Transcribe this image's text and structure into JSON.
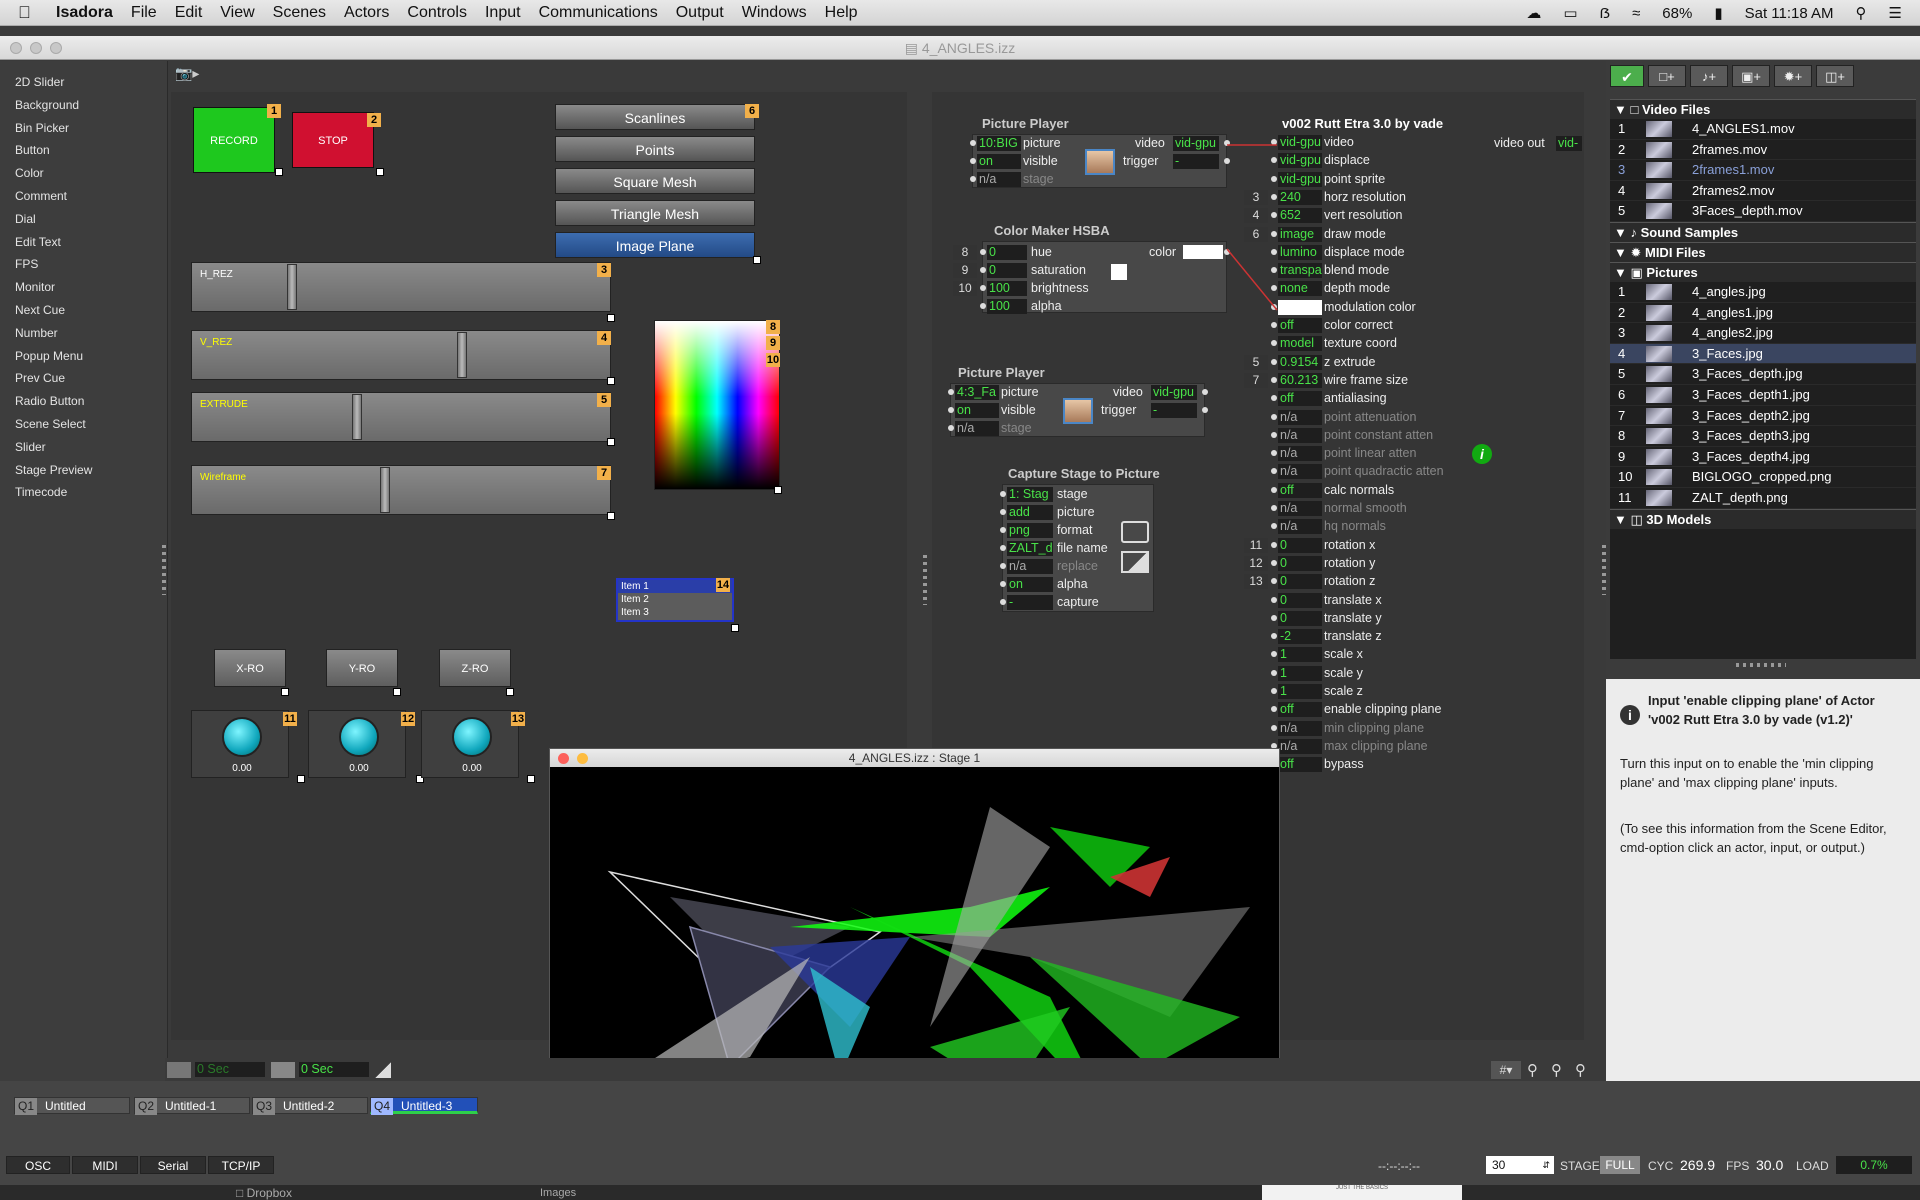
{
  "menubar": {
    "app": "Isadora",
    "items": [
      "File",
      "Edit",
      "View",
      "Scenes",
      "Actors",
      "Controls",
      "Input",
      "Communications",
      "Output",
      "Windows",
      "Help"
    ],
    "battery": "68%",
    "clock": "Sat 11:18 AM"
  },
  "window": {
    "title": "4_ANGLES.izz"
  },
  "toolbox": [
    "2D Slider",
    "Background",
    "Bin Picker",
    "Button",
    "Color",
    "Comment",
    "Dial",
    "Edit Text",
    "FPS",
    "Monitor",
    "Next Cue",
    "Number",
    "Popup Menu",
    "Prev Cue",
    "Radio Button",
    "Scene Select",
    "Slider",
    "Stage Preview",
    "Timecode"
  ],
  "control": {
    "record": "RECORD",
    "record_id": "1",
    "stop": "STOP",
    "stop_id": "2",
    "radio": [
      "Scanlines",
      "Points",
      "Square Mesh",
      "Triangle Mesh",
      "Image Plane"
    ],
    "radio_id": "6",
    "sliders": [
      {
        "label": "H_REZ",
        "id": "3",
        "value": 0.16
      },
      {
        "label": "V_REZ",
        "id": "4",
        "value": 0.52
      },
      {
        "label": "EXTRUDE",
        "id": "5",
        "value": 0.32
      },
      {
        "label": "Wireframe",
        "id": "7",
        "value": 0.38
      }
    ],
    "color_ids": [
      "8",
      "9",
      "10"
    ],
    "popup": [
      "Item 1",
      "Item 2",
      "Item 3"
    ],
    "popup_id": "14",
    "knobs": [
      {
        "label": "X-RO",
        "id": "11",
        "value": "0.00"
      },
      {
        "label": "Y-RO",
        "id": "12",
        "value": "0.00"
      },
      {
        "label": "Z-RO",
        "id": "13",
        "value": "0.00"
      }
    ]
  },
  "pp1": {
    "title": "Picture Player",
    "rows": [
      [
        "10:BIG",
        "picture"
      ],
      [
        "on",
        "visible"
      ],
      [
        "n/a",
        "stage"
      ]
    ],
    "out": [
      [
        "video",
        "vid-gpu"
      ],
      [
        "trigger",
        "-"
      ]
    ]
  },
  "cm": {
    "title": "Color Maker HSBA",
    "rows": [
      [
        "8",
        "0",
        "hue"
      ],
      [
        "9",
        "0",
        "saturation"
      ],
      [
        "10",
        "100",
        "brightness"
      ],
      [
        "",
        "100",
        "alpha"
      ]
    ],
    "out": "color"
  },
  "pp2": {
    "title": "Picture Player",
    "rows": [
      [
        "4:3_Fa",
        "picture"
      ],
      [
        "on",
        "visible"
      ],
      [
        "n/a",
        "stage"
      ]
    ],
    "out": [
      [
        "video",
        "vid-gpu"
      ],
      [
        "trigger",
        "-"
      ]
    ]
  },
  "cap": {
    "title": "Capture Stage to Picture",
    "rows": [
      [
        "1: Stag",
        "stage"
      ],
      [
        "add",
        "picture"
      ],
      [
        "png",
        "format"
      ],
      [
        "ZALT_d",
        "file name"
      ],
      [
        "n/a",
        "replace"
      ],
      [
        "on",
        "alpha"
      ],
      [
        "-",
        "capture"
      ]
    ]
  },
  "rutt": {
    "title": "v002 Rutt Etra 3.0 by vade",
    "out": "video out",
    "out_val": "vid-",
    "rows": [
      [
        "",
        "vid-gpu",
        "video",
        0
      ],
      [
        "",
        "vid-gpu",
        "displace",
        0
      ],
      [
        "",
        "vid-gpu",
        "point sprite",
        0
      ],
      [
        "3",
        "240",
        "horz resolution",
        0
      ],
      [
        "4",
        "652",
        "vert resolution",
        0
      ],
      [
        "6",
        "image",
        "draw mode",
        0
      ],
      [
        "",
        "lumino",
        "displace mode",
        0
      ],
      [
        "",
        "transpa",
        "blend mode",
        0
      ],
      [
        "",
        "none",
        "depth mode",
        0
      ],
      [
        "",
        "",
        "modulation color",
        0
      ],
      [
        "",
        "off",
        "color correct",
        0
      ],
      [
        "",
        "model",
        "texture coord",
        0
      ],
      [
        "5",
        "0.9154",
        "z extrude",
        0
      ],
      [
        "7",
        "60.213",
        "wire frame size",
        0
      ],
      [
        "",
        "off",
        "antialiasing",
        0
      ],
      [
        "",
        "n/a",
        "point attenuation",
        1
      ],
      [
        "",
        "n/a",
        "point constant atten",
        1
      ],
      [
        "",
        "n/a",
        "point linear atten",
        1
      ],
      [
        "",
        "n/a",
        "point quadractic atten",
        1
      ],
      [
        "",
        "off",
        "calc normals",
        0
      ],
      [
        "",
        "n/a",
        "normal smooth",
        1
      ],
      [
        "",
        "n/a",
        "hq normals",
        1
      ],
      [
        "11",
        "0",
        "rotation x",
        0
      ],
      [
        "12",
        "0",
        "rotation y",
        0
      ],
      [
        "13",
        "0",
        "rotation z",
        0
      ],
      [
        "",
        "0",
        "translate x",
        0
      ],
      [
        "",
        "0",
        "translate y",
        0
      ],
      [
        "",
        "-2",
        "translate z",
        0
      ],
      [
        "",
        "1",
        "scale x",
        0
      ],
      [
        "",
        "1",
        "scale y",
        0
      ],
      [
        "",
        "1",
        "scale z",
        0
      ],
      [
        "",
        "off",
        "enable clipping plane",
        0
      ],
      [
        "",
        "n/a",
        "min clipping plane",
        1
      ],
      [
        "",
        "n/a",
        "max clipping plane",
        1
      ],
      [
        "",
        "off",
        "bypass",
        0
      ]
    ]
  },
  "stage": {
    "title": "4_ANGLES.izz : Stage 1"
  },
  "media": {
    "video_head": "Video Files",
    "video": [
      [
        "1",
        "4_ANGLES1.mov"
      ],
      [
        "2",
        "2frames.mov"
      ],
      [
        "3",
        "2frames1.mov"
      ],
      [
        "4",
        "2frames2.mov"
      ],
      [
        "5",
        "3Faces_depth.mov"
      ]
    ],
    "sound_head": "Sound Samples",
    "midi_head": "MIDI Files",
    "pictures_head": "Pictures",
    "pictures": [
      [
        "1",
        "4_angles.jpg"
      ],
      [
        "2",
        "4_angles1.jpg"
      ],
      [
        "3",
        "4_angles2.jpg"
      ],
      [
        "4",
        "3_Faces.jpg"
      ],
      [
        "5",
        "3_Faces_depth.jpg"
      ],
      [
        "6",
        "3_Faces_depth1.jpg"
      ],
      [
        "7",
        "3_Faces_depth2.jpg"
      ],
      [
        "8",
        "3_Faces_depth3.jpg"
      ],
      [
        "9",
        "3_Faces_depth4.jpg"
      ],
      [
        "10",
        "BIGLOGO_cropped.png"
      ],
      [
        "11",
        "ZALT_depth.png"
      ]
    ],
    "models_head": "3D Models"
  },
  "info": {
    "title": "Input 'enable clipping plane' of Actor 'v002 Rutt Etra 3.0 by vade (v1.2)'",
    "body": "Turn this input on to enable the 'min clipping plane' and 'max clipping plane' inputs.",
    "hint": "(To see this information from the Scene Editor, cmd-option click an actor, input, or output.)"
  },
  "timebar": {
    "t1": "0 Sec",
    "t2": "0 Sec"
  },
  "scenes": [
    [
      "Q1",
      "Untitled"
    ],
    [
      "Q2",
      "Untitled-1"
    ],
    [
      "Q3",
      "Untitled-2"
    ],
    [
      "Q4",
      "Untitled-3"
    ]
  ],
  "bottom": {
    "buttons": [
      "OSC",
      "MIDI",
      "Serial",
      "TCP/IP"
    ],
    "timecode": "--:--:--:--",
    "fps_setting": "30",
    "stage_label": "STAGE",
    "stage_mode": "FULL",
    "cyc_label": "CYC",
    "cyc": "269.9",
    "fps_label": "FPS",
    "fps": "30.0",
    "load_label": "LOAD",
    "load": "0.7%"
  },
  "dock": {
    "d1": "Dropbox",
    "d2": "Images",
    "d3": "JUST THE BASICS"
  },
  "colors": {
    "record": "#1ec81e",
    "stop": "#d01030",
    "value_text": "#49e249",
    "radio_selected": "#2b4f86"
  }
}
